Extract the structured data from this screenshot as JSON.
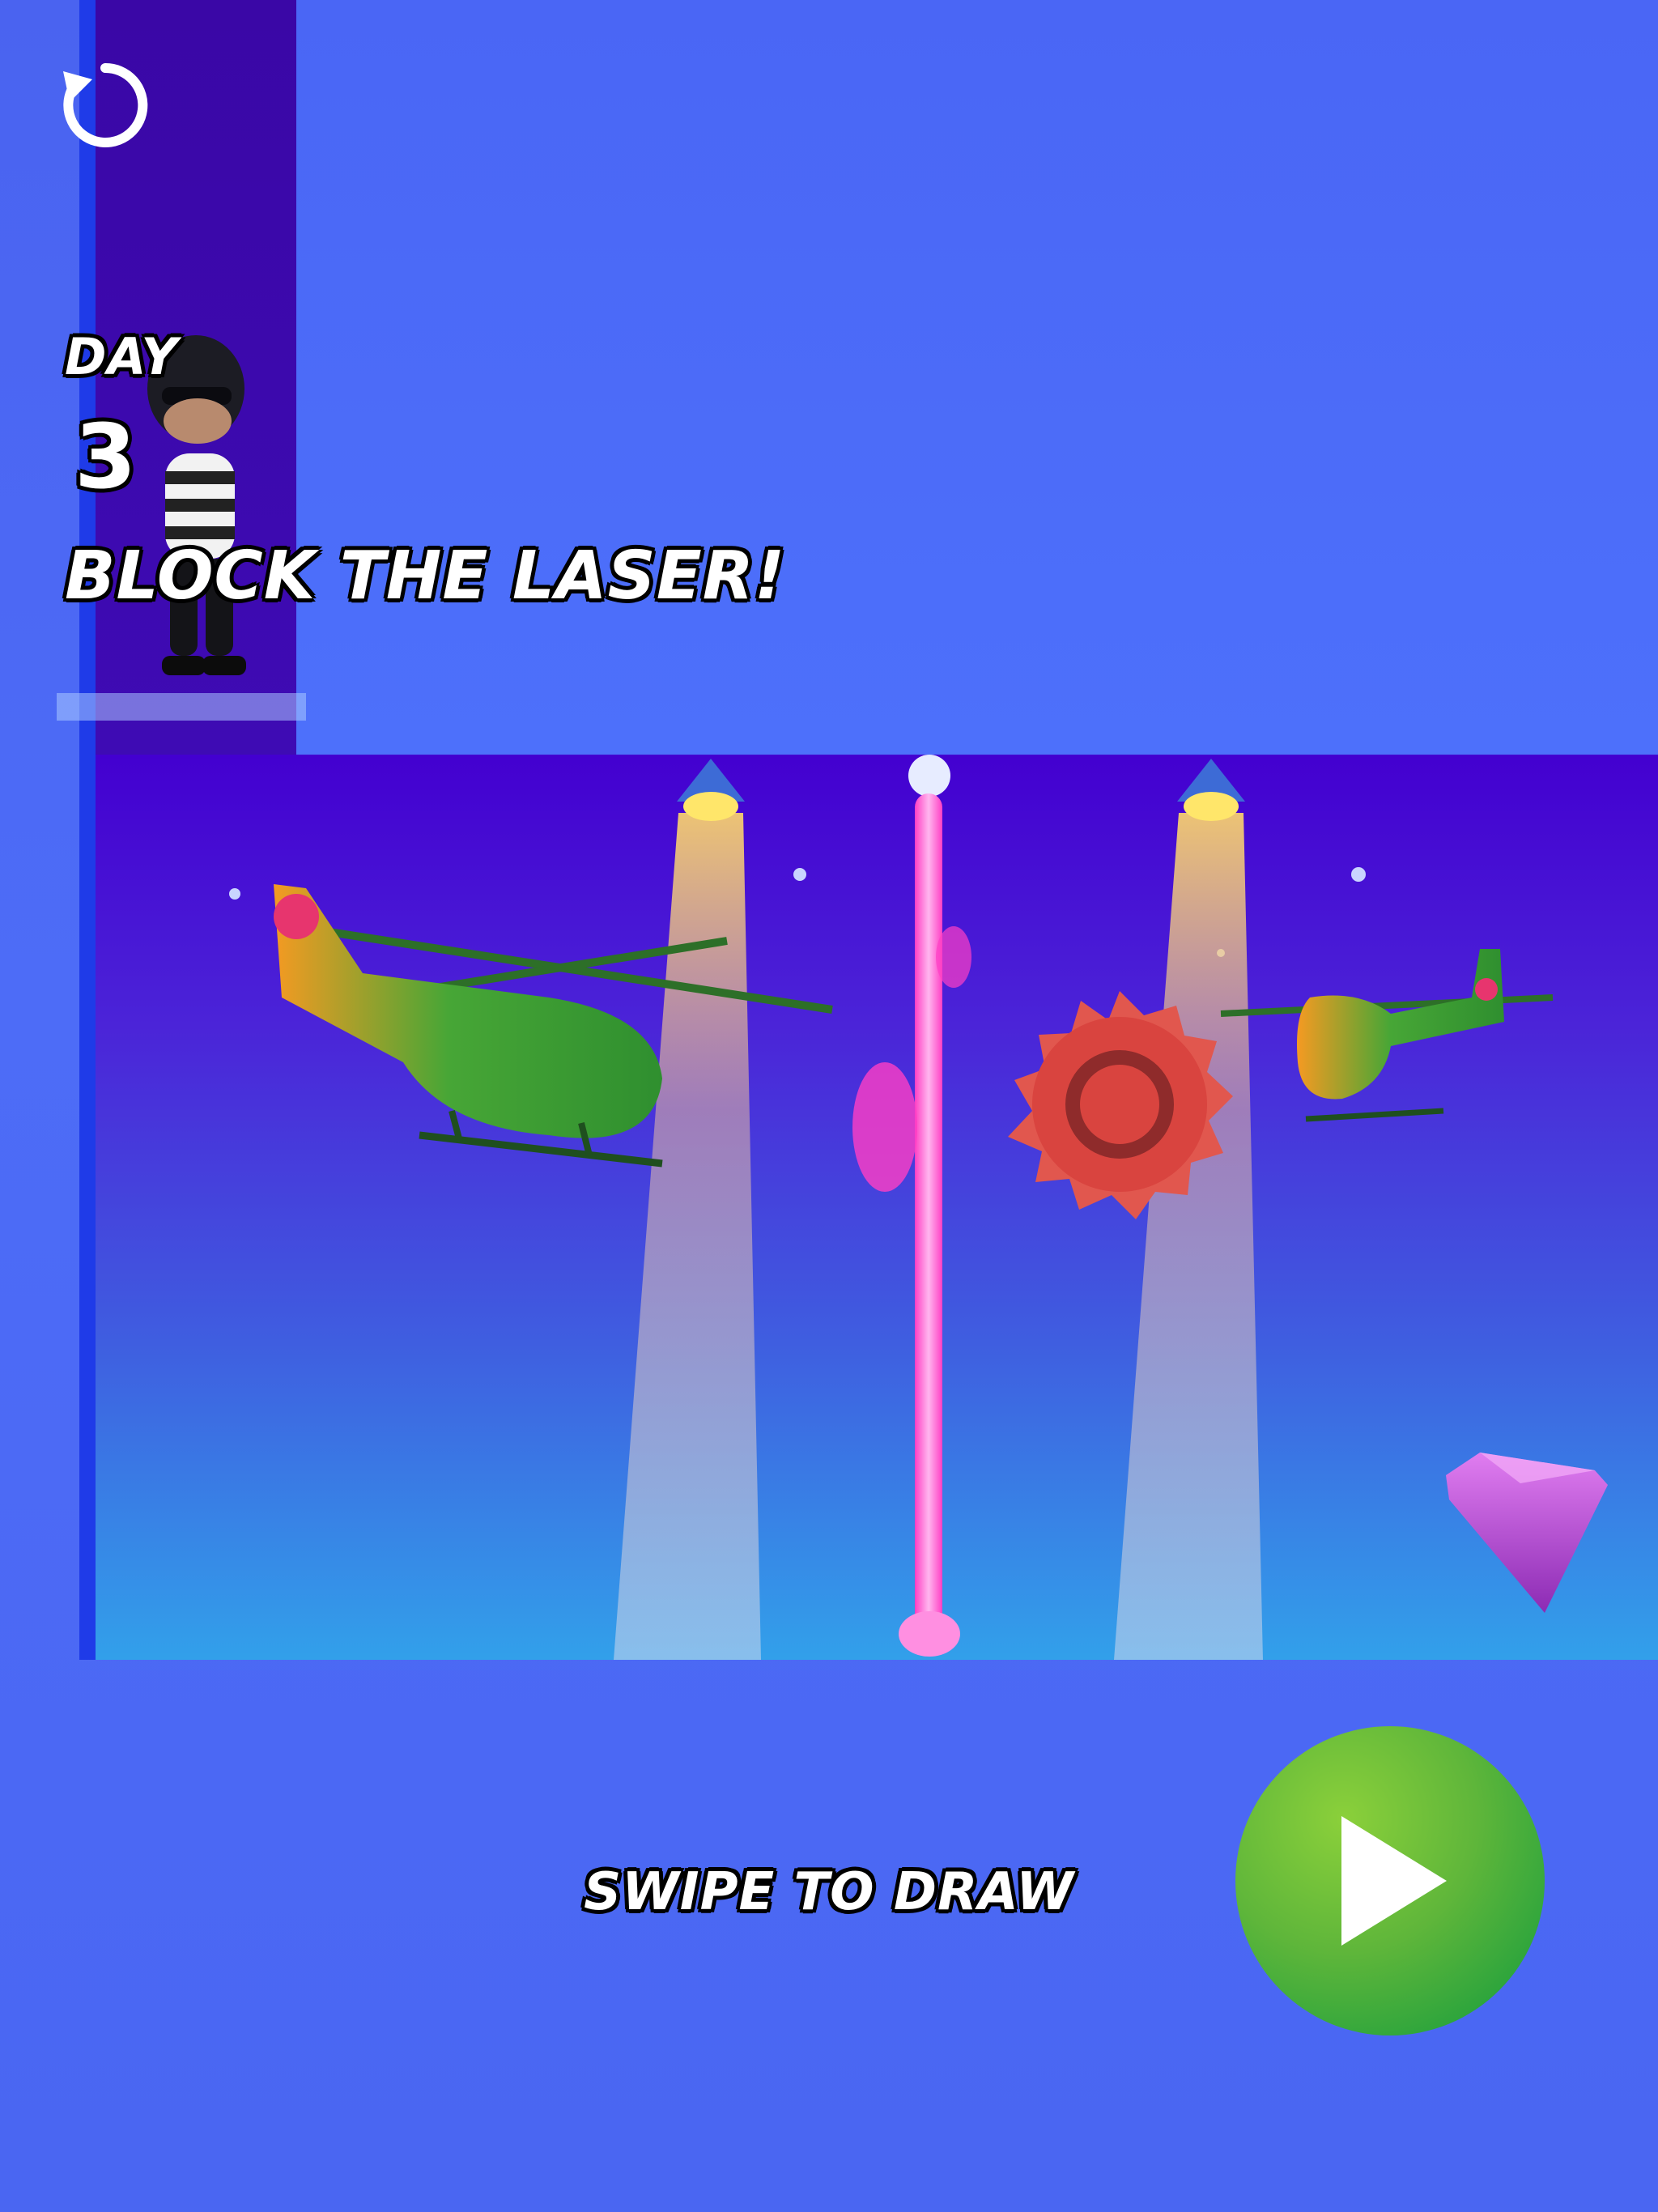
{
  "hud": {
    "day_label": "DAY",
    "day_number": "3",
    "objective": "BLOCK THE LASER!"
  },
  "footer": {
    "instruction": "SWIPE TO DRAW"
  },
  "controls": {
    "restart_icon": "restart-icon",
    "play_icon": "play-icon"
  },
  "colors": {
    "play_button": "#5fb63a",
    "laser": "#ff5fd2",
    "saw_blade": "#d9443f",
    "gem": "#c43ad6",
    "helicopter_body": "#3f9a35",
    "helicopter_accent": "#f28c1e"
  }
}
